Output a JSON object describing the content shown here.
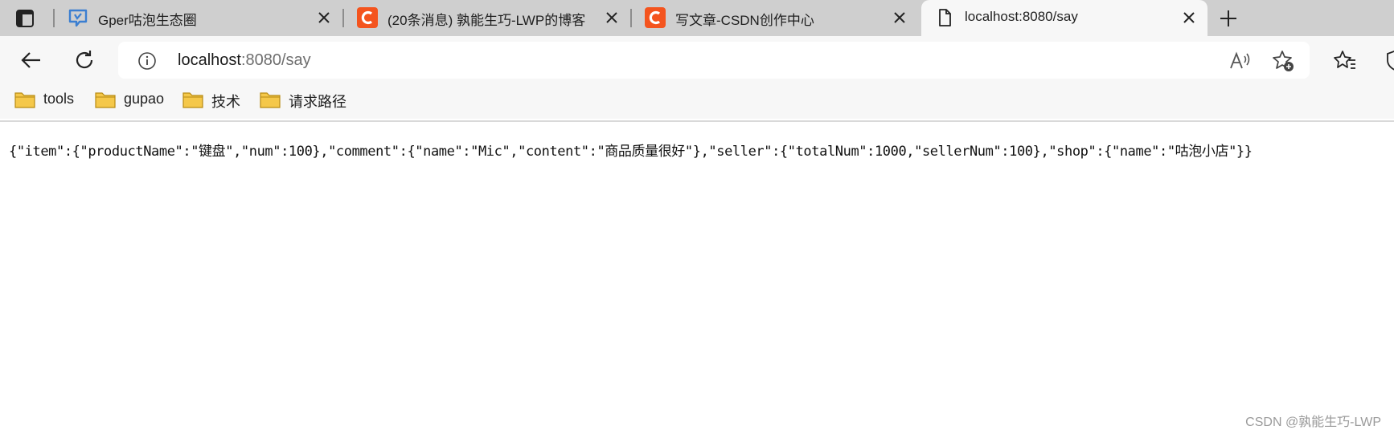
{
  "tabs": [
    {
      "title": "Gper咕泡生态圈",
      "favicon": "gper-icon"
    },
    {
      "title": "(20条消息) 孰能生巧-LWP的博客",
      "favicon": "csdn-icon"
    },
    {
      "title": "写文章-CSDN创作中心",
      "favicon": "csdn-icon"
    },
    {
      "title": "localhost:8080/say",
      "favicon": "page-icon",
      "active": true
    }
  ],
  "address": {
    "host": "localhost",
    "rest": ":8080/say"
  },
  "bookmarks": [
    {
      "label": "tools"
    },
    {
      "label": "gupao"
    },
    {
      "label": "技术"
    },
    {
      "label": "请求路径"
    }
  ],
  "page_body": "{\"item\":{\"productName\":\"键盘\",\"num\":100},\"comment\":{\"name\":\"Mic\",\"content\":\"商品质量很好\"},\"seller\":{\"totalNum\":1000,\"sellerNum\":100},\"shop\":{\"name\":\"咕泡小店\"}}",
  "watermark": "CSDN @孰能生巧-LWP",
  "colors": {
    "tabstrip": "#cfcfcf",
    "toolbar": "#f7f7f7",
    "csdn": "#f4541e",
    "gper": "#3b7fd1",
    "folder": "#f5c84a"
  }
}
